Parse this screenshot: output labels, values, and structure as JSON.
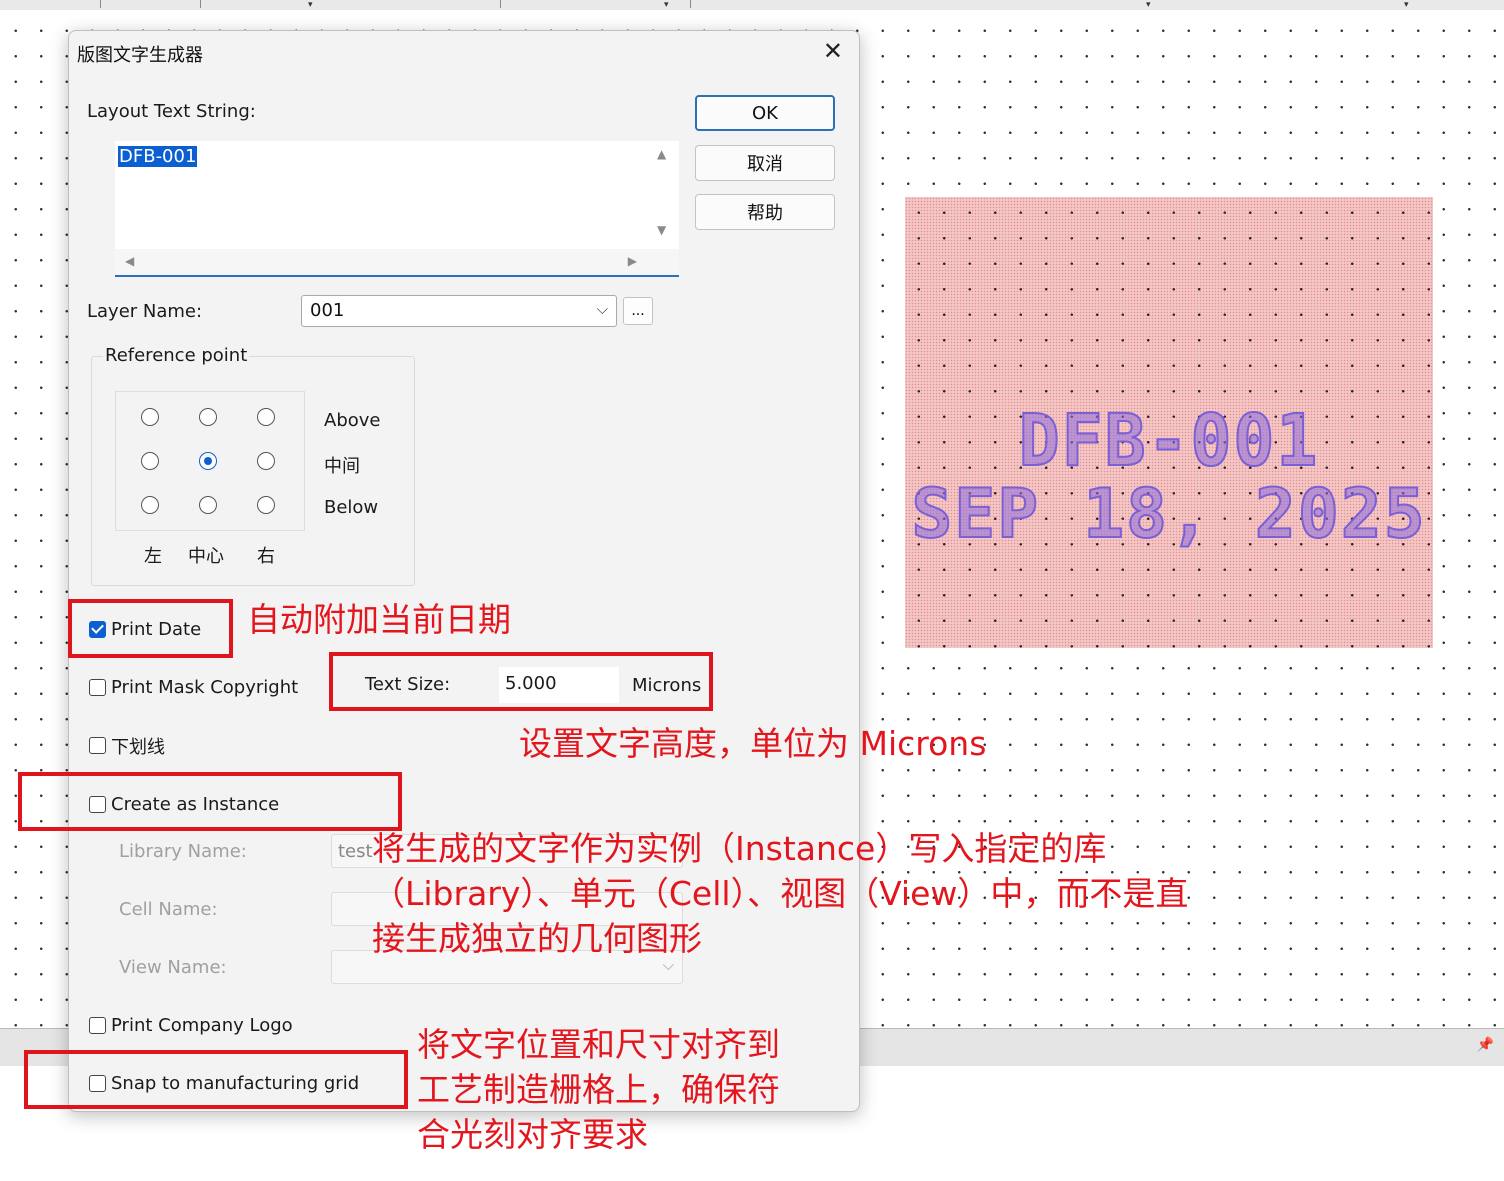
{
  "dialog": {
    "title": "版图文字生成器",
    "layout_text_label": "Layout Text String:",
    "layout_text_value": "DFB-001",
    "ok_label": "OK",
    "cancel_label": "取消",
    "help_label": "帮助",
    "layer_label": "Layer Name:",
    "layer_value": "001",
    "layer_more_label": "...",
    "reference_point": {
      "title": "Reference point",
      "rows": [
        "Above",
        "中间",
        "Below"
      ],
      "cols": [
        "左",
        "中心",
        "右"
      ],
      "selected": "中间-中心"
    },
    "print_date_label": "Print Date",
    "print_date_checked": true,
    "print_mask_label": "Print Mask Copyright",
    "print_mask_checked": false,
    "text_size_label": "Text Size:",
    "text_size_value": "5.000",
    "text_size_unit": "Microns",
    "underline_label": "下划线",
    "underline_checked": false,
    "create_instance_label": "Create as Instance",
    "create_instance_checked": false,
    "library_label": "Library Name:",
    "library_value": "test",
    "cell_label": "Cell Name:",
    "view_label": "View Name:",
    "company_logo_label": "Print Company Logo",
    "company_logo_checked": false,
    "snap_label": "Snap to manufacturing grid",
    "snap_checked": false
  },
  "preview": {
    "line1": "DFB-001",
    "line2": "SEP 18, 2025",
    "colors": {
      "fill": "#f4c6c6",
      "text": "#7a5fd6"
    }
  },
  "annotations": {
    "print_date": "自动附加当前日期",
    "text_size": "设置文字高度，单位为 Microns",
    "instance_line1": "将生成的文字作为实例（Instance）写入指定的库",
    "instance_line2": "（Library）、单元（Cell）、视图（View）中，而不是直",
    "instance_line3": "接生成独立的几何图形",
    "snap_line1": "将文字位置和尺寸对齐到",
    "snap_line2": "工艺制造栅格上，确保符",
    "snap_line3": "合光刻对齐要求",
    "color": "#e3161e"
  }
}
